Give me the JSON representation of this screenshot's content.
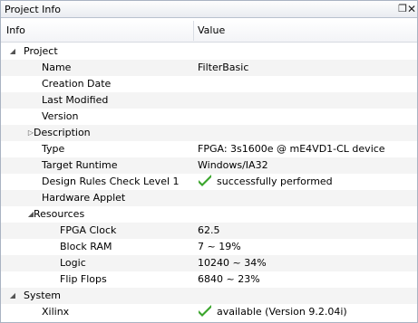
{
  "window": {
    "title": "Project Info"
  },
  "columns": {
    "info": "Info",
    "value": "Value"
  },
  "rows": [
    {
      "label": "Project",
      "value": "",
      "level": 0,
      "expander": "expanded",
      "check": false
    },
    {
      "label": "Name",
      "value": "FilterBasic",
      "level": 2,
      "expander": "none",
      "check": false
    },
    {
      "label": "Creation Date",
      "value": "",
      "level": 2,
      "expander": "none",
      "check": false
    },
    {
      "label": "Last Modified",
      "value": "",
      "level": 2,
      "expander": "none",
      "check": false
    },
    {
      "label": "Version",
      "value": "",
      "level": 2,
      "expander": "none",
      "check": false
    },
    {
      "label": "Description",
      "value": "",
      "level": 1,
      "expander": "collapsed",
      "check": false
    },
    {
      "label": "Type",
      "value": "FPGA: 3s1600e @ mE4VD1-CL device",
      "level": 2,
      "expander": "none",
      "check": false
    },
    {
      "label": "Target Runtime",
      "value": "Windows/IA32",
      "level": 2,
      "expander": "none",
      "check": false
    },
    {
      "label": "Design Rules Check Level 1",
      "value": "successfully performed",
      "level": 2,
      "expander": "none",
      "check": true
    },
    {
      "label": "Hardware Applet",
      "value": "",
      "level": 2,
      "expander": "none",
      "check": false
    },
    {
      "label": "Resources",
      "value": "",
      "level": 1,
      "expander": "expanded",
      "check": false
    },
    {
      "label": "FPGA Clock",
      "value": "62.5",
      "level": 3,
      "expander": "none",
      "check": false
    },
    {
      "label": "Block RAM",
      "value": "7 ~ 19%",
      "level": 3,
      "expander": "none",
      "check": false
    },
    {
      "label": "Logic",
      "value": "10240 ~ 34%",
      "level": 3,
      "expander": "none",
      "check": false
    },
    {
      "label": "Flip Flops",
      "value": "6840 ~ 23%",
      "level": 3,
      "expander": "none",
      "check": false
    },
    {
      "label": "System",
      "value": "",
      "level": 0,
      "expander": "expanded",
      "check": false
    },
    {
      "label": "Xilinx",
      "value": "available (Version 9.2.04i)",
      "level": 2,
      "expander": "none",
      "check": true
    }
  ],
  "colors": {
    "check": "#3aa52c",
    "alt_row": "#f4f4f4"
  },
  "icons": {
    "restore": "restore-icon",
    "close": "close-icon",
    "check": "checkmark-icon"
  }
}
